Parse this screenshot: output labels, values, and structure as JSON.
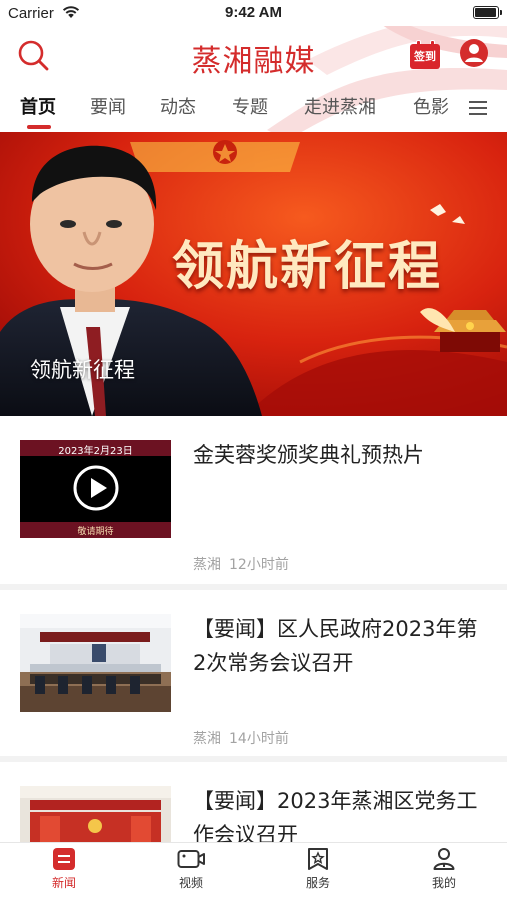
{
  "status_bar": {
    "carrier": "Carrier",
    "time": "9:42 AM"
  },
  "header": {
    "app_title": "蒸湘融媒",
    "checkin_label": "签到"
  },
  "tabs": [
    {
      "label": "首页",
      "active": true
    },
    {
      "label": "要闻"
    },
    {
      "label": "动态"
    },
    {
      "label": "专题"
    },
    {
      "label": "走进蒸湘"
    },
    {
      "label": "色影"
    }
  ],
  "banner": {
    "caption": "领航新征程",
    "headline": "领航新征程"
  },
  "news": [
    {
      "title": "金芙蓉奖颁奖典礼预热片",
      "source": "蒸湘",
      "time": "12小时前",
      "thumb_date": "2023年2月23日",
      "thumb_footer": "敬请期待"
    },
    {
      "title": "【要闻】区人民政府2023年第2次常务会议召开",
      "source": "蒸湘",
      "time": "14小时前"
    },
    {
      "title": "【要闻】2023年蒸湘区党务工作会议召开"
    }
  ],
  "bottom_nav": [
    {
      "label": "新闻",
      "icon": "news-icon",
      "active": true
    },
    {
      "label": "视频",
      "icon": "video-icon"
    },
    {
      "label": "服务",
      "icon": "service-icon"
    },
    {
      "label": "我的",
      "icon": "user-icon"
    }
  ],
  "colors": {
    "brand": "#d42c2c",
    "banner_red": "#c81d11"
  }
}
